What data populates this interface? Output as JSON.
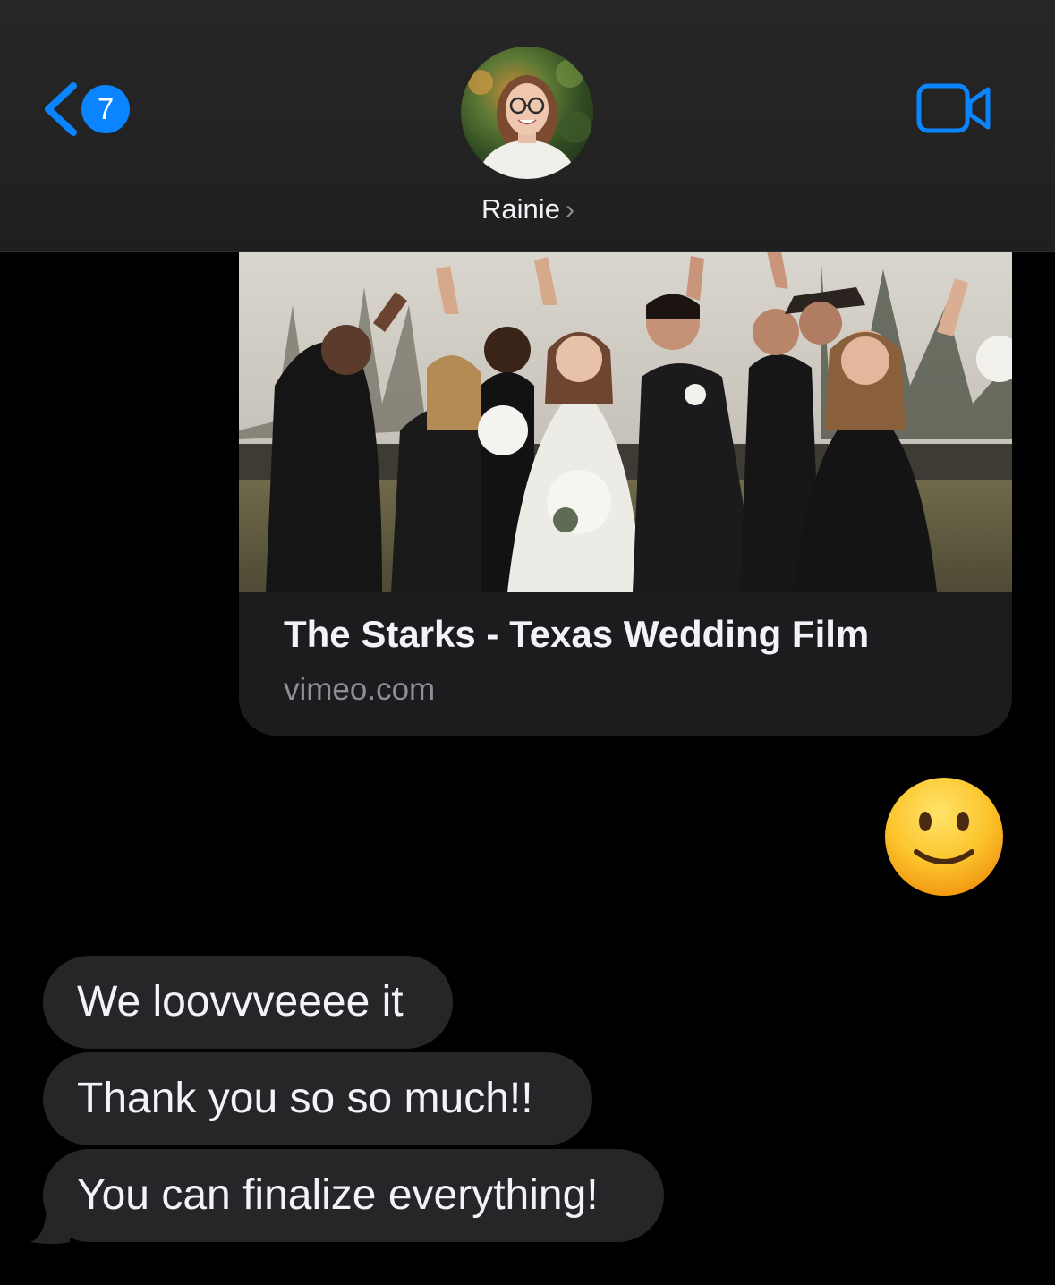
{
  "header": {
    "back_badge_count": "7",
    "contact_name": "Rainie",
    "accent_color": "#0a84ff"
  },
  "messages": {
    "link_preview": {
      "title": "The Starks - Texas Wedding Film",
      "domain": "vimeo.com"
    },
    "emoji_reply": "🙂",
    "incoming": [
      {
        "text": "We loovvveeee it"
      },
      {
        "text": "Thank you so so much!!"
      },
      {
        "text": "You can finalize everything!"
      }
    ]
  },
  "icons": {
    "back": "chevron-left-icon",
    "video": "video-camera-icon",
    "contact_chevron": "chevron-right-icon"
  }
}
